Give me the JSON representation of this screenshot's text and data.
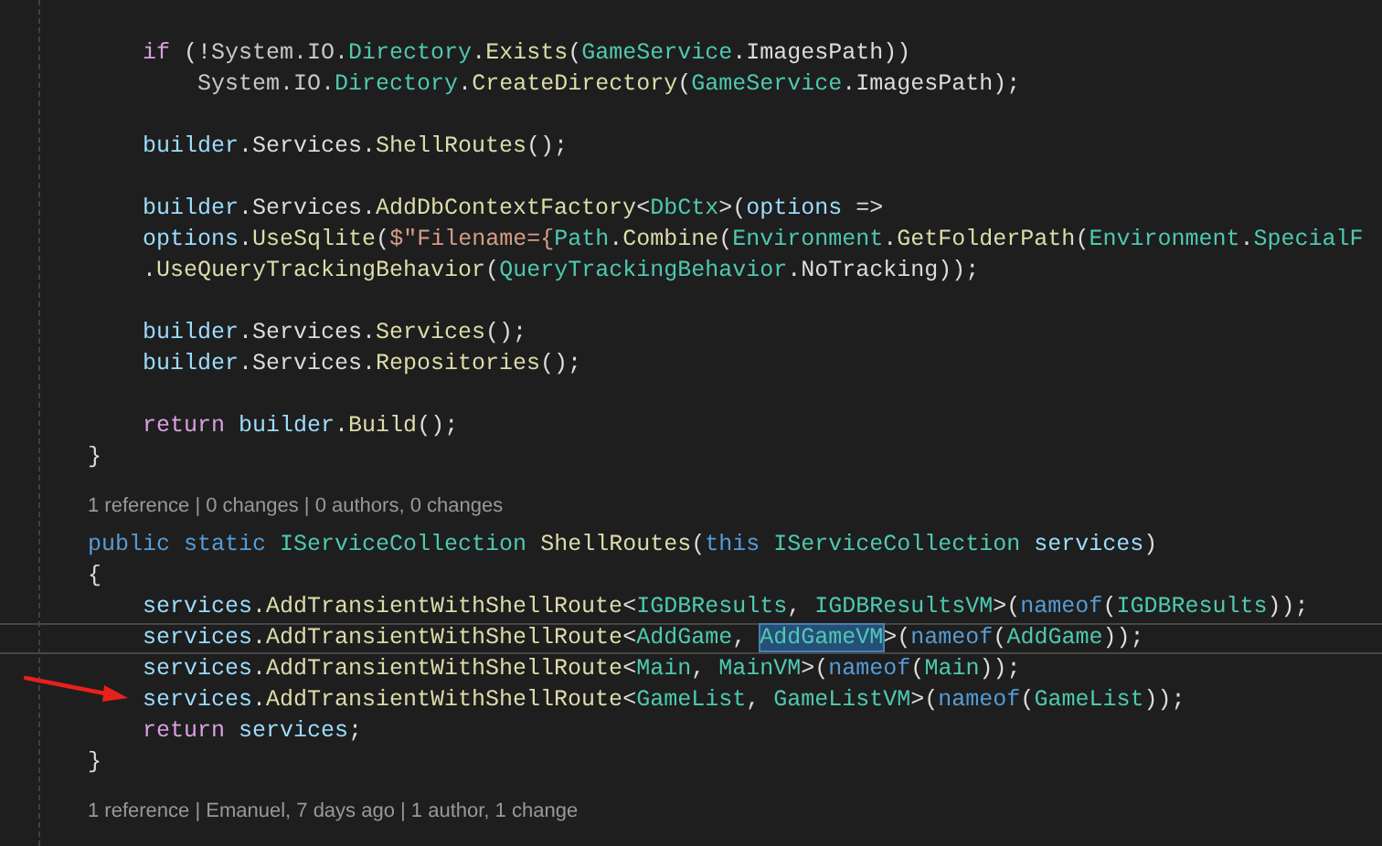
{
  "editor": {
    "lines": [
      {
        "kind": "code",
        "current": false,
        "tokens": [
          {
            "kind": "control",
            "t": "    if"
          },
          {
            "kind": "plain",
            "t": " (!"
          },
          {
            "kind": "namespace",
            "t": "System.IO."
          },
          {
            "kind": "type",
            "t": "Directory"
          },
          {
            "kind": "plain",
            "t": "."
          },
          {
            "kind": "method",
            "t": "Exists"
          },
          {
            "kind": "plain",
            "t": "("
          },
          {
            "kind": "type",
            "t": "GameService"
          },
          {
            "kind": "plain",
            "t": ".ImagesPath))"
          }
        ]
      },
      {
        "kind": "code",
        "current": false,
        "tokens": [
          {
            "kind": "namespace",
            "t": "        System.IO."
          },
          {
            "kind": "type",
            "t": "Directory"
          },
          {
            "kind": "plain",
            "t": "."
          },
          {
            "kind": "method",
            "t": "CreateDirectory"
          },
          {
            "kind": "plain",
            "t": "("
          },
          {
            "kind": "type",
            "t": "GameService"
          },
          {
            "kind": "plain",
            "t": ".ImagesPath);"
          }
        ]
      },
      {
        "kind": "blank",
        "current": false
      },
      {
        "kind": "code",
        "current": false,
        "tokens": [
          {
            "kind": "variable",
            "t": "    builder"
          },
          {
            "kind": "plain",
            "t": ".Services."
          },
          {
            "kind": "method",
            "t": "ShellRoutes"
          },
          {
            "kind": "plain",
            "t": "();"
          }
        ]
      },
      {
        "kind": "blank",
        "current": false
      },
      {
        "kind": "code",
        "current": false,
        "tokens": [
          {
            "kind": "variable",
            "t": "    builder"
          },
          {
            "kind": "plain",
            "t": ".Services."
          },
          {
            "kind": "method",
            "t": "AddDbContextFactory"
          },
          {
            "kind": "plain",
            "t": "<"
          },
          {
            "kind": "type",
            "t": "DbCtx"
          },
          {
            "kind": "plain",
            "t": ">("
          },
          {
            "kind": "variable",
            "t": "options"
          },
          {
            "kind": "plain",
            "t": " =>"
          }
        ]
      },
      {
        "kind": "code",
        "current": false,
        "tokens": [
          {
            "kind": "variable",
            "t": "    options"
          },
          {
            "kind": "plain",
            "t": "."
          },
          {
            "kind": "method",
            "t": "UseSqlite"
          },
          {
            "kind": "plain",
            "t": "("
          },
          {
            "kind": "string",
            "t": "$\"Filename={"
          },
          {
            "kind": "type",
            "t": "Path"
          },
          {
            "kind": "plain",
            "t": "."
          },
          {
            "kind": "method",
            "t": "Combine"
          },
          {
            "kind": "plain",
            "t": "("
          },
          {
            "kind": "type",
            "t": "Environment"
          },
          {
            "kind": "plain",
            "t": "."
          },
          {
            "kind": "method",
            "t": "GetFolderPath"
          },
          {
            "kind": "plain",
            "t": "("
          },
          {
            "kind": "type",
            "t": "Environment"
          },
          {
            "kind": "plain",
            "t": "."
          },
          {
            "kind": "type",
            "t": "SpecialF"
          }
        ]
      },
      {
        "kind": "code",
        "current": false,
        "tokens": [
          {
            "kind": "plain",
            "t": "    ."
          },
          {
            "kind": "method",
            "t": "UseQueryTrackingBehavior"
          },
          {
            "kind": "plain",
            "t": "("
          },
          {
            "kind": "type",
            "t": "QueryTrackingBehavior"
          },
          {
            "kind": "plain",
            "t": ".NoTracking));"
          }
        ]
      },
      {
        "kind": "blank",
        "current": false
      },
      {
        "kind": "code",
        "current": false,
        "tokens": [
          {
            "kind": "variable",
            "t": "    builder"
          },
          {
            "kind": "plain",
            "t": ".Services."
          },
          {
            "kind": "method",
            "t": "Services"
          },
          {
            "kind": "plain",
            "t": "();"
          }
        ]
      },
      {
        "kind": "code",
        "current": false,
        "tokens": [
          {
            "kind": "variable",
            "t": "    builder"
          },
          {
            "kind": "plain",
            "t": ".Services."
          },
          {
            "kind": "method",
            "t": "Repositories"
          },
          {
            "kind": "plain",
            "t": "();"
          }
        ]
      },
      {
        "kind": "blank",
        "current": false
      },
      {
        "kind": "code",
        "current": false,
        "tokens": [
          {
            "kind": "control",
            "t": "    return"
          },
          {
            "kind": "variable",
            "t": " builder"
          },
          {
            "kind": "plain",
            "t": "."
          },
          {
            "kind": "method",
            "t": "Build"
          },
          {
            "kind": "plain",
            "t": "();"
          }
        ]
      },
      {
        "kind": "code",
        "current": false,
        "tokens": [
          {
            "kind": "plain",
            "t": "}"
          }
        ]
      },
      {
        "kind": "codelens",
        "current": false,
        "text": "1 reference | 0 changes | 0 authors, 0 changes"
      },
      {
        "kind": "code",
        "current": false,
        "tokens": [
          {
            "kind": "keyword",
            "t": "public static "
          },
          {
            "kind": "type",
            "t": "IServiceCollection "
          },
          {
            "kind": "method",
            "t": "ShellRoutes"
          },
          {
            "kind": "plain",
            "t": "("
          },
          {
            "kind": "keyword",
            "t": "this "
          },
          {
            "kind": "type",
            "t": "IServiceCollection "
          },
          {
            "kind": "variable",
            "t": "services"
          },
          {
            "kind": "plain",
            "t": ")"
          }
        ]
      },
      {
        "kind": "code",
        "current": false,
        "tokens": [
          {
            "kind": "plain",
            "t": "{"
          }
        ]
      },
      {
        "kind": "code",
        "current": false,
        "tokens": [
          {
            "kind": "variable",
            "t": "    services"
          },
          {
            "kind": "plain",
            "t": "."
          },
          {
            "kind": "method",
            "t": "AddTransientWithShellRoute"
          },
          {
            "kind": "plain",
            "t": "<"
          },
          {
            "kind": "type",
            "t": "IGDBResults"
          },
          {
            "kind": "plain",
            "t": ", "
          },
          {
            "kind": "type",
            "t": "IGDBResultsVM"
          },
          {
            "kind": "plain",
            "t": ">("
          },
          {
            "kind": "keyword",
            "t": "nameof"
          },
          {
            "kind": "plain",
            "t": "("
          },
          {
            "kind": "type",
            "t": "IGDBResults"
          },
          {
            "kind": "plain",
            "t": "));"
          }
        ]
      },
      {
        "kind": "code",
        "current": true,
        "tokens": [
          {
            "kind": "variable",
            "t": "    services"
          },
          {
            "kind": "plain",
            "t": "."
          },
          {
            "kind": "method",
            "t": "AddTransientWithShellRoute"
          },
          {
            "kind": "plain",
            "t": "<"
          },
          {
            "kind": "type",
            "t": "AddGame"
          },
          {
            "kind": "plain",
            "t": ", "
          },
          {
            "kind": "highlighted",
            "t": "AddGameVM"
          },
          {
            "kind": "plain",
            "t": ">("
          },
          {
            "kind": "keyword",
            "t": "nameof"
          },
          {
            "kind": "plain",
            "t": "("
          },
          {
            "kind": "type",
            "t": "AddGame"
          },
          {
            "kind": "plain",
            "t": "));"
          }
        ]
      },
      {
        "kind": "code",
        "current": false,
        "tokens": [
          {
            "kind": "variable",
            "t": "    services"
          },
          {
            "kind": "plain",
            "t": "."
          },
          {
            "kind": "method",
            "t": "AddTransientWithShellRoute"
          },
          {
            "kind": "plain",
            "t": "<"
          },
          {
            "kind": "type",
            "t": "Main"
          },
          {
            "kind": "plain",
            "t": ", "
          },
          {
            "kind": "type",
            "t": "MainVM"
          },
          {
            "kind": "plain",
            "t": ">("
          },
          {
            "kind": "keyword",
            "t": "nameof"
          },
          {
            "kind": "plain",
            "t": "("
          },
          {
            "kind": "type",
            "t": "Main"
          },
          {
            "kind": "plain",
            "t": "));"
          }
        ]
      },
      {
        "kind": "code",
        "current": false,
        "tokens": [
          {
            "kind": "variable",
            "t": "    services"
          },
          {
            "kind": "plain",
            "t": "."
          },
          {
            "kind": "method",
            "t": "AddTransientWithShellRoute"
          },
          {
            "kind": "plain",
            "t": "<"
          },
          {
            "kind": "type",
            "t": "GameList"
          },
          {
            "kind": "plain",
            "t": ", "
          },
          {
            "kind": "type",
            "t": "GameListVM"
          },
          {
            "kind": "plain",
            "t": ">("
          },
          {
            "kind": "keyword",
            "t": "nameof"
          },
          {
            "kind": "plain",
            "t": "("
          },
          {
            "kind": "type",
            "t": "GameList"
          },
          {
            "kind": "plain",
            "t": "));"
          }
        ]
      },
      {
        "kind": "code",
        "current": false,
        "tokens": [
          {
            "kind": "control",
            "t": "    return"
          },
          {
            "kind": "variable",
            "t": " services"
          },
          {
            "kind": "plain",
            "t": ";"
          }
        ]
      },
      {
        "kind": "code",
        "current": false,
        "tokens": [
          {
            "kind": "plain",
            "t": "}"
          }
        ]
      },
      {
        "kind": "codelens",
        "current": false,
        "text": "1 reference | Emanuel, 7 days ago | 1 author, 1 change"
      }
    ]
  }
}
